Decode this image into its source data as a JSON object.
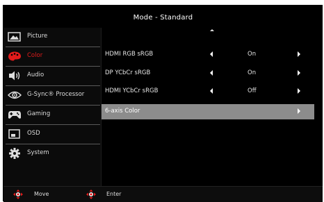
{
  "title": "Mode - Standard",
  "sidebar": {
    "items": [
      {
        "label": "Picture",
        "icon": "picture-icon"
      },
      {
        "label": "Color",
        "icon": "color-palette-icon",
        "active": true
      },
      {
        "label": "Audio",
        "icon": "speaker-icon"
      },
      {
        "label": "G-Sync® Processor",
        "icon": "gsync-eye-icon"
      },
      {
        "label": "Gaming",
        "icon": "gamepad-icon"
      },
      {
        "label": "OSD",
        "icon": "osd-window-icon"
      },
      {
        "label": "System",
        "icon": "gear-icon"
      }
    ]
  },
  "main": {
    "rows": [
      {
        "label": "HDMI RGB sRGB",
        "value": "On"
      },
      {
        "label": "DP YCbCr sRGB",
        "value": "On"
      },
      {
        "label": "HDMI YCbCr sRGB",
        "value": "Off"
      },
      {
        "label": "6-axis Color",
        "value": ""
      }
    ],
    "selected_index": 3
  },
  "footer": {
    "move_label": "Move",
    "enter_label": "Enter"
  },
  "colors": {
    "accent": "#e21b1b",
    "selected_row": "#8c8c8c",
    "background": "#000000"
  }
}
